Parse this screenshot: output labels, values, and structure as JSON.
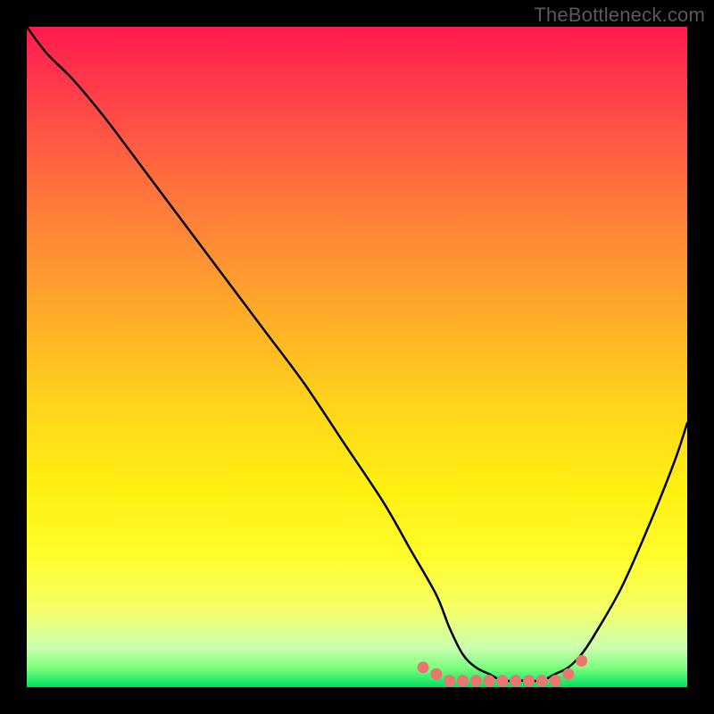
{
  "watermark": "TheBottleneck.com",
  "colors": {
    "page_bg": "#000000",
    "curve_stroke": "#000000",
    "marker_fill": "#e9766f",
    "gradient_top": "#ff1a4d",
    "gradient_bottom": "#00e060"
  },
  "chart_data": {
    "type": "line",
    "title": "",
    "xlabel": "",
    "ylabel": "",
    "xlim": [
      0,
      100
    ],
    "ylim": [
      0,
      100
    ],
    "grid": false,
    "legend": false,
    "series": [
      {
        "name": "bottleneck-curve",
        "x": [
          0,
          3,
          7,
          12,
          18,
          24,
          30,
          36,
          42,
          48,
          54,
          58,
          62,
          64,
          66,
          68,
          70,
          72,
          74,
          76,
          78,
          80,
          82,
          84,
          86,
          90,
          94,
          98,
          100
        ],
        "y": [
          100,
          96,
          92,
          86,
          78,
          70,
          62,
          54,
          46,
          37,
          28,
          21,
          14,
          9,
          5,
          3,
          2,
          1,
          1,
          1,
          1,
          2,
          3,
          5,
          8,
          15,
          24,
          34,
          40
        ]
      }
    ],
    "markers": {
      "name": "trough-markers",
      "x": [
        60,
        62,
        64,
        66,
        68,
        70,
        72,
        74,
        76,
        78,
        80,
        82,
        84
      ],
      "y": [
        3,
        2,
        1,
        1,
        1,
        1,
        1,
        1,
        1,
        1,
        1,
        2,
        4
      ]
    }
  }
}
